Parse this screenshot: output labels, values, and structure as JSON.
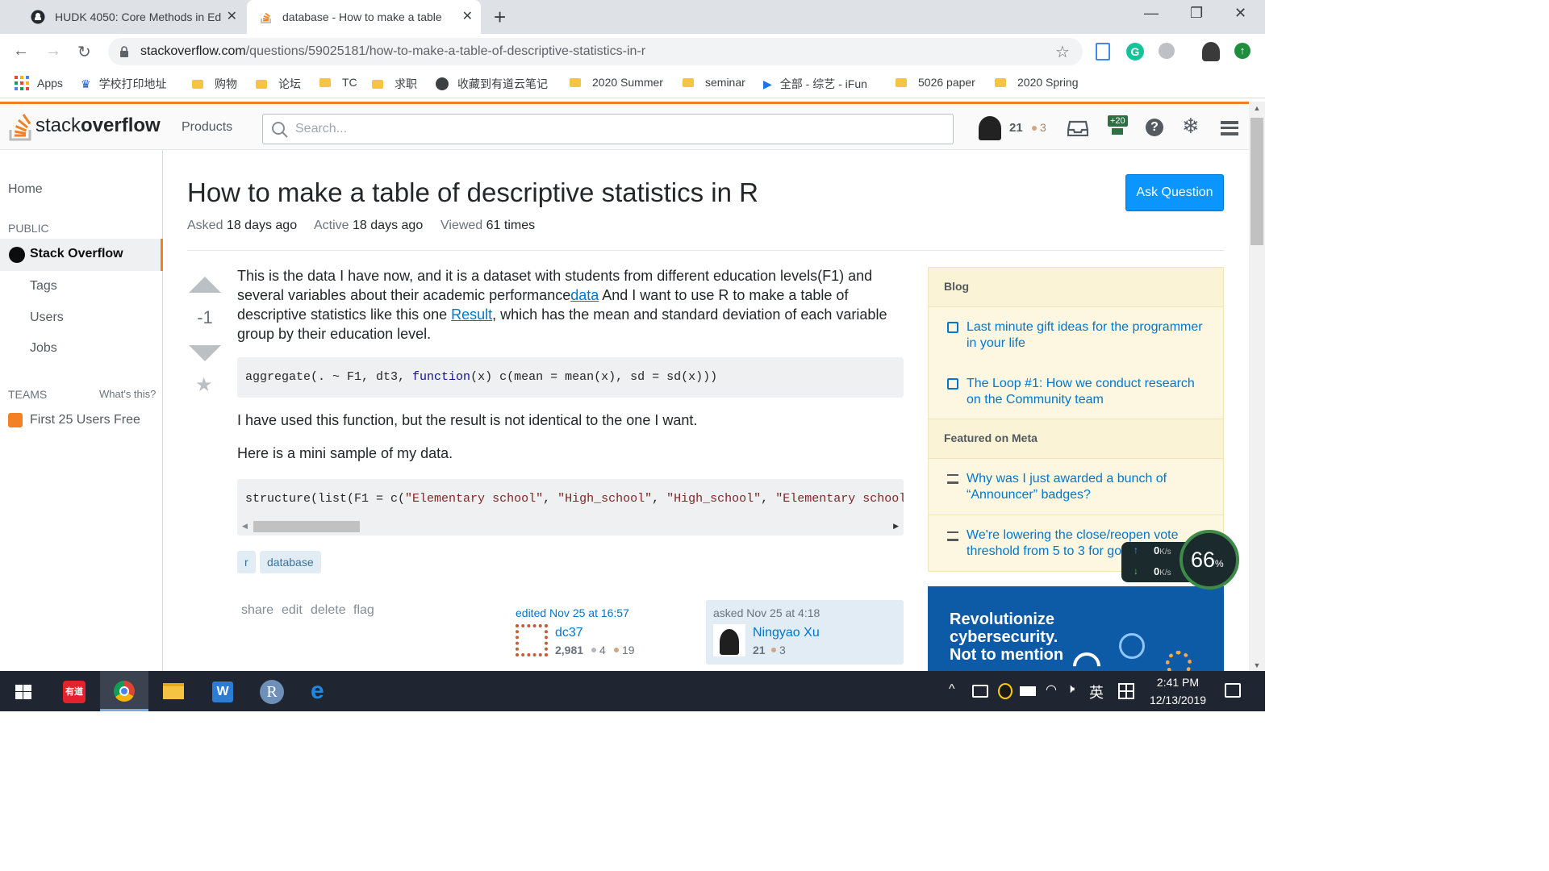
{
  "browser": {
    "tabs": [
      {
        "title": "HUDK 4050: Core Methods in Ed",
        "icon": "github-icon",
        "active": false
      },
      {
        "title": "database - How to make a table",
        "icon": "stackoverflow-icon",
        "active": true
      }
    ],
    "new_tab": "+",
    "url_host": "stackoverflow.com",
    "url_path": "/questions/59025181/how-to-make-a-table-of-descriptive-statistics-in-r",
    "bookmarks": [
      "Apps",
      "学校打印地址",
      "购物",
      "论坛",
      "TC",
      "求职",
      "收藏到有道云笔记",
      "2020 Summer",
      "seminar",
      "全部 - 综艺 - iFun",
      "5026 paper",
      "2020 Spring"
    ]
  },
  "so_header": {
    "logo_light": "stack",
    "logo_bold": "overflow",
    "products": "Products",
    "search_placeholder": "Search...",
    "reputation": "21",
    "bronze": "3",
    "achievement_badge": "+20"
  },
  "left_nav": {
    "home": "Home",
    "public": "PUBLIC",
    "stack_overflow": "Stack Overflow",
    "tags": "Tags",
    "users": "Users",
    "jobs": "Jobs",
    "teams": "TEAMS",
    "whats_this": "What's this?",
    "teams_offer": "First 25 Users Free"
  },
  "question": {
    "title": "How to make a table of descriptive statistics in R",
    "asked_label": "Asked",
    "asked_value": "18 days ago",
    "active_label": "Active",
    "active_value": "18 days ago",
    "viewed_label": "Viewed",
    "viewed_value": "61 times",
    "ask_button": "Ask Question",
    "score": "-1",
    "body_p1_a": "This is the data I have now, and it is a dataset with students from different education levels(F1) and several variables about their academic performance",
    "body_link1": "data",
    "body_p1_b": " And I want to use R to make a table of descriptive statistics like this one ",
    "body_link2": "Result",
    "body_p1_c": ", which has the mean and standard deviation of each variable group by their education level.",
    "code1_a": "aggregate(. ~ F1, dt3, ",
    "code1_kw": "function",
    "code1_b": "(x) c(mean = mean(x), sd = sd(x)))",
    "body_p2": "I have used this function, but the result is not identical to the one I want.",
    "body_p3": "Here is a mini sample of my data.",
    "code2_a": "structure(list(F1 = c(",
    "code2_s1": "\"Elementary school\"",
    "code2_s2": "\"High_school\"",
    "code2_s3": "\"High_school\"",
    "code2_s4": "\"Elementary school\"",
    "tags": [
      "r",
      "database"
    ],
    "post_menu": [
      "share",
      "edit",
      "delete",
      "flag"
    ],
    "edited_label": "edited Nov 25 at 16:57",
    "editor_name": "dc37",
    "editor_rep": "2,981",
    "editor_silver": "4",
    "editor_bronze": "19",
    "asked_card_label": "asked Nov 25 at 4:18",
    "asker_name": "Ningyao Xu",
    "asker_rep": "21",
    "asker_bronze": "3"
  },
  "sidebar": {
    "blog_header": "Blog",
    "blog_items": [
      "Last minute gift ideas for the programmer in your life",
      "The Loop #1: How we conduct research on the Community team"
    ],
    "meta_header": "Featured on Meta",
    "meta_items": [
      "Why was I just awarded a bunch of “Announcer” badges?",
      "We're lowering the close/reopen vote threshold from 5 to 3 for goo"
    ],
    "ad_text": "Revolutionize cybersecurity. Not to mention"
  },
  "net_widget": {
    "up": "0",
    "down": "0",
    "unit": "K/s",
    "percent": "66",
    "percent_sign": "%"
  },
  "taskbar": {
    "time": "2:41 PM",
    "date": "12/13/2019",
    "ime": "英",
    "app_label": "有道"
  },
  "colors": {
    "so_orange": "#f48024",
    "link_blue": "#0077cc",
    "button_blue": "#0a95ff",
    "tag_bg": "#e1ecf4",
    "taskbar": "#1f2631"
  }
}
